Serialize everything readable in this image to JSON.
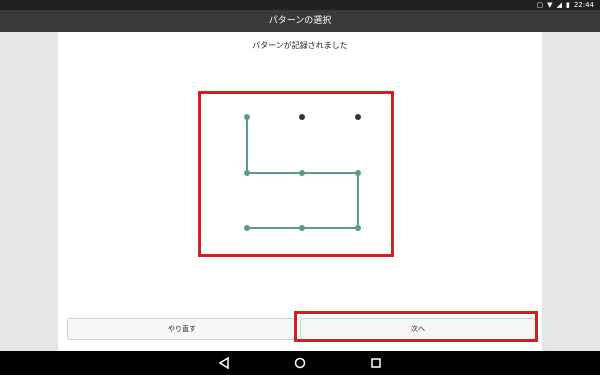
{
  "status_bar": {
    "time": "22:44"
  },
  "title_bar": {
    "title": "パターンの選択"
  },
  "main": {
    "subtitle": "パターンが記録されました",
    "pattern": {
      "grid": [
        [
          {
            "selected": true
          },
          {
            "selected": false
          },
          {
            "selected": false
          }
        ],
        [
          {
            "selected": true
          },
          {
            "selected": true
          },
          {
            "selected": true
          }
        ],
        [
          {
            "selected": true
          },
          {
            "selected": true
          },
          {
            "selected": true
          }
        ]
      ],
      "path_colors": {
        "line": "#5a9c86",
        "dot_selected": "#5a9c86",
        "dot_unselected": "#333333"
      },
      "highlight_color": "#d01f1f"
    }
  },
  "buttons": {
    "retry_label": "やり直す",
    "next_label": "次へ"
  },
  "nav": {
    "back_icon": "back-icon",
    "home_icon": "home-icon",
    "recents_icon": "recents-icon"
  }
}
